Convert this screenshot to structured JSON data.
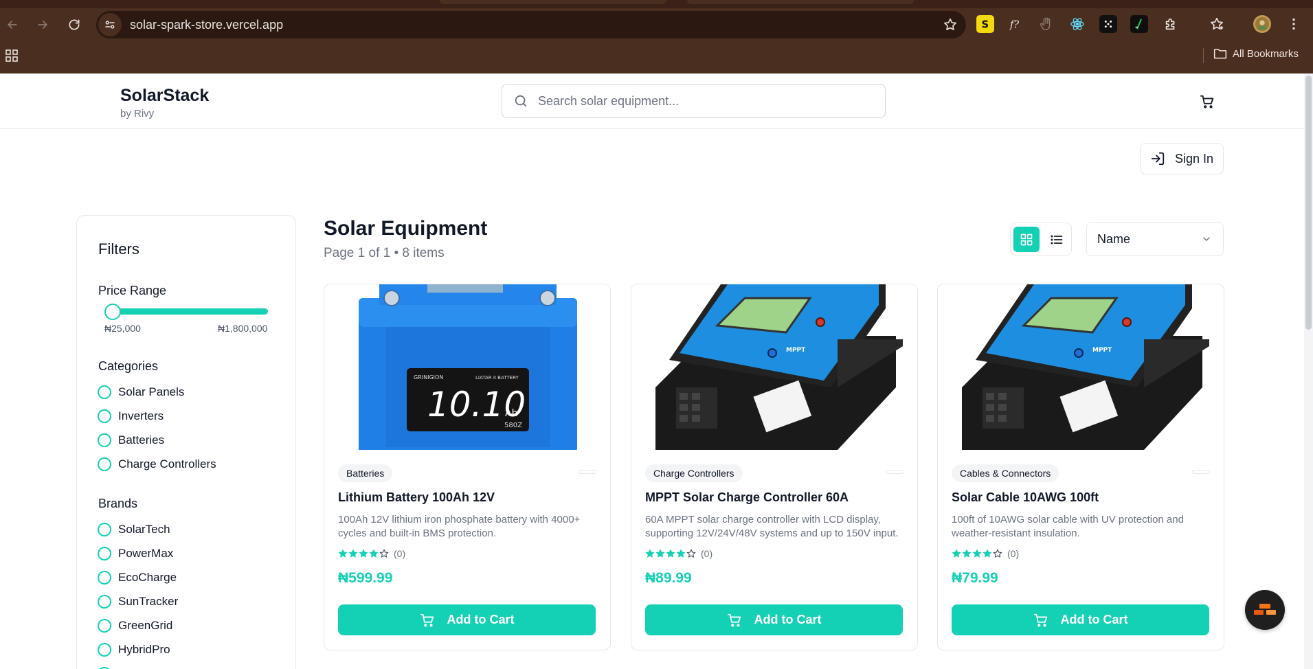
{
  "browser": {
    "url": "solar-spark-store.vercel.app",
    "bookmarks_label": "All Bookmarks",
    "extensions": [
      "s-extension-icon",
      "function-extension-icon",
      "hand-extension-icon",
      "react-devtools-icon",
      "dots-extension-icon",
      "terminal-extension-icon",
      "puzzle-extensions-icon",
      "reading-list-icon",
      "profile-avatar",
      "kebab-menu-icon"
    ]
  },
  "header": {
    "brand": "SolarStack",
    "brand_sub": "by Rivy",
    "search_placeholder": "Search solar equipment...",
    "sign_in_label": "Sign In"
  },
  "filters": {
    "title": "Filters",
    "price_range": {
      "label": "Price Range",
      "min_label": "₦25,000",
      "max_label": "₦1,800,000",
      "thumb_position": 0
    },
    "categories": {
      "label": "Categories",
      "items": [
        "Solar Panels",
        "Inverters",
        "Batteries",
        "Charge Controllers"
      ]
    },
    "brands": {
      "label": "Brands",
      "items": [
        "SolarTech",
        "PowerMax",
        "EcoCharge",
        "SunTracker",
        "GreenGrid",
        "HybridPro"
      ]
    }
  },
  "main": {
    "title": "Solar Equipment",
    "subtitle": "Page 1 of 1 • 8 items",
    "sort_value": "Name",
    "products": [
      {
        "category": "Batteries",
        "title": "Lithium Battery 100Ah 12V",
        "description": "100Ah 12V lithium iron phosphate battery with 4000+ cycles and built-in BMS protection.",
        "rating": 4,
        "reviews": "(0)",
        "price": "₦599.99",
        "button": "Add to Cart",
        "image_text": {
          "brand": "GRINIGION",
          "type": "LIATAR II BATTERY",
          "reading": "10.10",
          "unit": "Ah",
          "code": "580Z"
        }
      },
      {
        "category": "Charge Controllers",
        "title": "MPPT Solar Charge Controller 60A",
        "description": "60A MPPT solar charge controller with LCD display, supporting 12V/24V/48V systems and up to 150V input.",
        "rating": 4,
        "reviews": "(0)",
        "price": "₦89.99",
        "button": "Add to Cart",
        "image_text": {
          "model": "MPPT"
        }
      },
      {
        "category": "Cables & Connectors",
        "title": "Solar Cable 10AWG 100ft",
        "description": "100ft of 10AWG solar cable with UV protection and weather-resistant insulation.",
        "rating": 4,
        "reviews": "(0)",
        "price": "₦79.99",
        "button": "Add to Cart",
        "image_text": {
          "model": "MPPT"
        }
      }
    ]
  },
  "colors": {
    "accent": "#14d0b4",
    "chrome_bg": "#4a2e20",
    "text_primary": "#111827",
    "text_muted": "#6b7280"
  }
}
